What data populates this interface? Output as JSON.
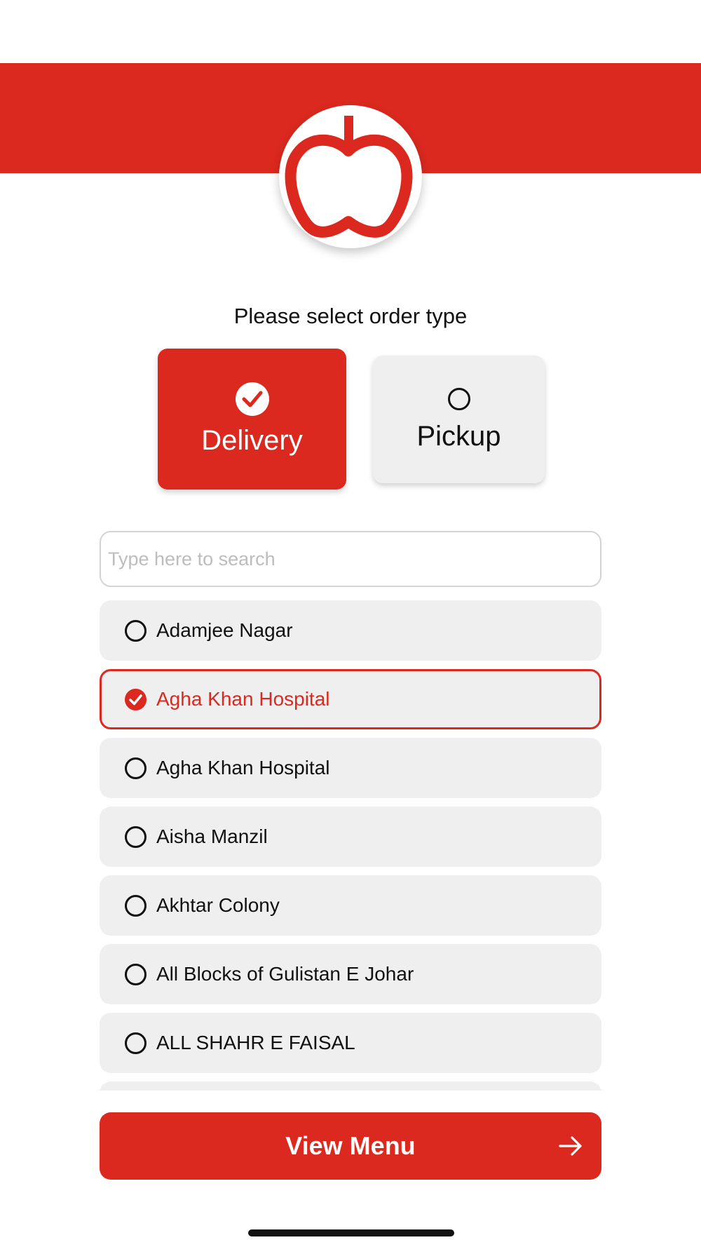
{
  "brand": {
    "accent_color": "#dc291f",
    "logo_icon": "apple-logo-icon"
  },
  "order_type": {
    "title": "Please select order type",
    "options": [
      {
        "label": "Delivery",
        "selected": true,
        "icon": "check-circle-icon"
      },
      {
        "label": "Pickup",
        "selected": false,
        "icon": "radio-empty-icon"
      }
    ]
  },
  "search": {
    "value": "",
    "placeholder": "Type here to search"
  },
  "areas": {
    "items": [
      {
        "label": "Adamjee Nagar",
        "selected": false
      },
      {
        "label": "Agha Khan Hospital",
        "selected": true
      },
      {
        "label": "Agha Khan Hospital",
        "selected": false
      },
      {
        "label": "Aisha Manzil",
        "selected": false
      },
      {
        "label": "Akhtar Colony",
        "selected": false
      },
      {
        "label": "All Blocks of Gulistan E Johar",
        "selected": false
      },
      {
        "label": "ALL SHAHR E FAISAL",
        "selected": false
      }
    ]
  },
  "footer": {
    "view_menu_label": "View Menu",
    "arrow_icon": "arrow-right-icon"
  }
}
